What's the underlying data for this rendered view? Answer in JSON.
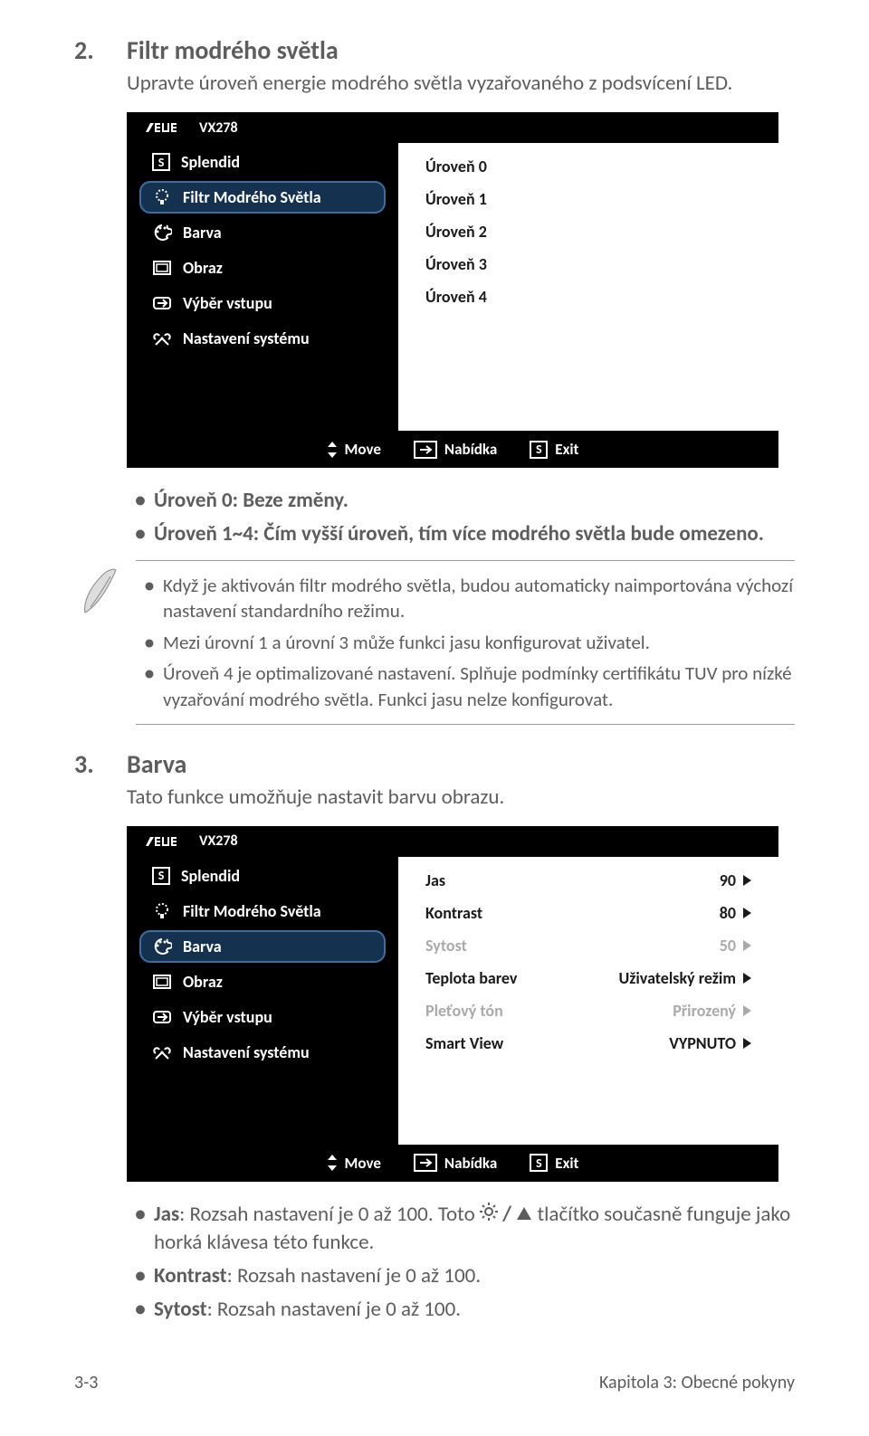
{
  "section2": {
    "num": "2.",
    "title": "Filtr modrého světla",
    "desc": "Upravte úroveň energie modrého světla vyzařovaného z podsvícení LED."
  },
  "osd1": {
    "model": "VX278",
    "menu": [
      {
        "label": "Splendid",
        "icon": "s"
      },
      {
        "label": "Filtr Modrého Světla",
        "icon": "bulb",
        "selected": true
      },
      {
        "label": "Barva",
        "icon": "palette"
      },
      {
        "label": "Obraz",
        "icon": "image"
      },
      {
        "label": "Výběr vstupu",
        "icon": "input"
      },
      {
        "label": "Nastavení systému",
        "icon": "tools"
      }
    ],
    "options": [
      {
        "label": "Úroveň 0"
      },
      {
        "label": "Úroveň 1"
      },
      {
        "label": "Úroveň 2"
      },
      {
        "label": "Úroveň 3"
      },
      {
        "label": "Úroveň 4"
      }
    ],
    "footer": {
      "move": "Move",
      "menu": "Nabídka",
      "exit": "Exit"
    }
  },
  "bullets1": [
    "Úroveň 0: Beze změny.",
    "Úroveň 1~4: Čím vyšší úroveň, tím více modrého světla bude omezeno."
  ],
  "noteBullets": [
    "Když je aktivován filtr modrého světla, budou automaticky naimportována výchozí nastavení standardního režimu.",
    "Mezi úrovní 1 a úrovní 3 může funkci jasu konfigurovat uživatel.",
    "Úroveň 4 je optimalizované nastavení. Splňuje podmínky certifikátu TUV pro nízké vyzařování modrého světla. Funkci jasu nelze konfigurovat."
  ],
  "section3": {
    "num": "3.",
    "title": "Barva",
    "desc": "Tato funkce umožňuje nastavit barvu obrazu."
  },
  "osd2": {
    "model": "VX278",
    "menu": [
      {
        "label": "Splendid",
        "icon": "s"
      },
      {
        "label": "Filtr Modrého Světla",
        "icon": "bulb"
      },
      {
        "label": "Barva",
        "icon": "palette",
        "selected": true
      },
      {
        "label": "Obraz",
        "icon": "image"
      },
      {
        "label": "Výběr vstupu",
        "icon": "input"
      },
      {
        "label": "Nastavení systému",
        "icon": "tools"
      }
    ],
    "options": [
      {
        "label": "Jas",
        "value": "90"
      },
      {
        "label": "Kontrast",
        "value": "80"
      },
      {
        "label": "Sytost",
        "value": "50",
        "dim": true
      },
      {
        "label": "Teplota barev",
        "value": "Uživatelský režim"
      },
      {
        "label": "Pleťový tón",
        "value": "Přirozený",
        "dim": true
      },
      {
        "label": "Smart View",
        "value": "VYPNUTO"
      }
    ],
    "footer": {
      "move": "Move",
      "menu": "Nabídka",
      "exit": "Exit"
    }
  },
  "bullets2": [
    {
      "pre": "Jas",
      "post": ": Rozsah nastavení je 0 až 100. Toto ",
      "post2": " tlačítko současně funguje jako horká klávesa této funkce."
    },
    {
      "pre": "Kontrast",
      "post": ": Rozsah nastavení je 0 až 100."
    },
    {
      "pre": "Sytost",
      "post": ": Rozsah nastavení je 0 až 100."
    }
  ],
  "footer": {
    "left": "3-3",
    "right": "Kapitola 3: Obecné pokyny"
  }
}
